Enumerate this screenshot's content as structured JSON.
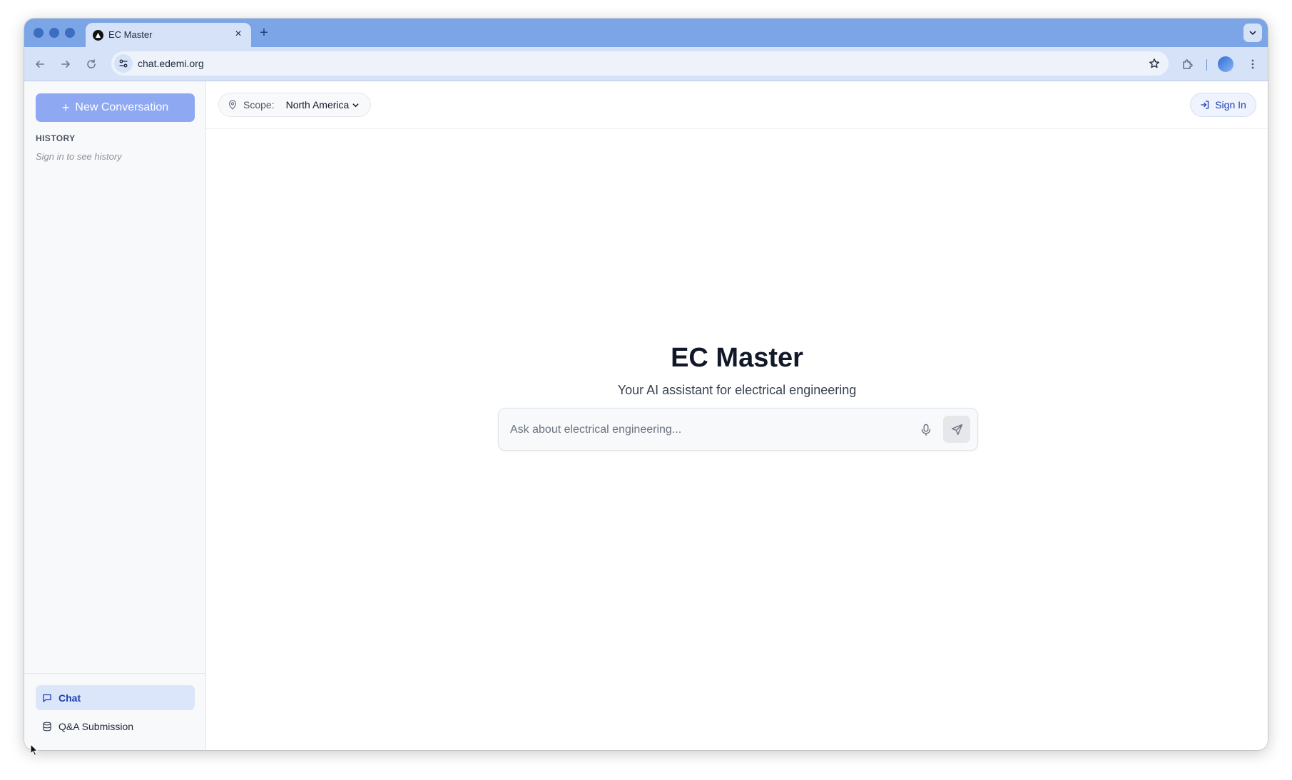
{
  "browser": {
    "tab_title": "EC Master",
    "tab_close": "×",
    "new_tab": "+",
    "url": "chat.edemi.org"
  },
  "sidebar": {
    "new_conversation_label": "New Conversation",
    "history_heading": "HISTORY",
    "history_empty": "Sign in to see history",
    "nav": [
      {
        "label": "Chat",
        "icon": "message-square-icon",
        "active": true
      },
      {
        "label": "Q&A Submission",
        "icon": "database-icon",
        "active": false
      }
    ]
  },
  "topbar": {
    "scope_label": "Scope:",
    "scope_value": "North America",
    "sign_in_label": "Sign In"
  },
  "hero": {
    "title": "EC Master",
    "subtitle": "Your AI assistant for electrical engineering"
  },
  "composer": {
    "placeholder": "Ask about electrical engineering...",
    "value": ""
  },
  "colors": {
    "accent": "#8ea8f1",
    "active_nav_bg": "#dbe6fb",
    "active_nav_text": "#1e40af",
    "tabbar": "#7ba5e6"
  }
}
